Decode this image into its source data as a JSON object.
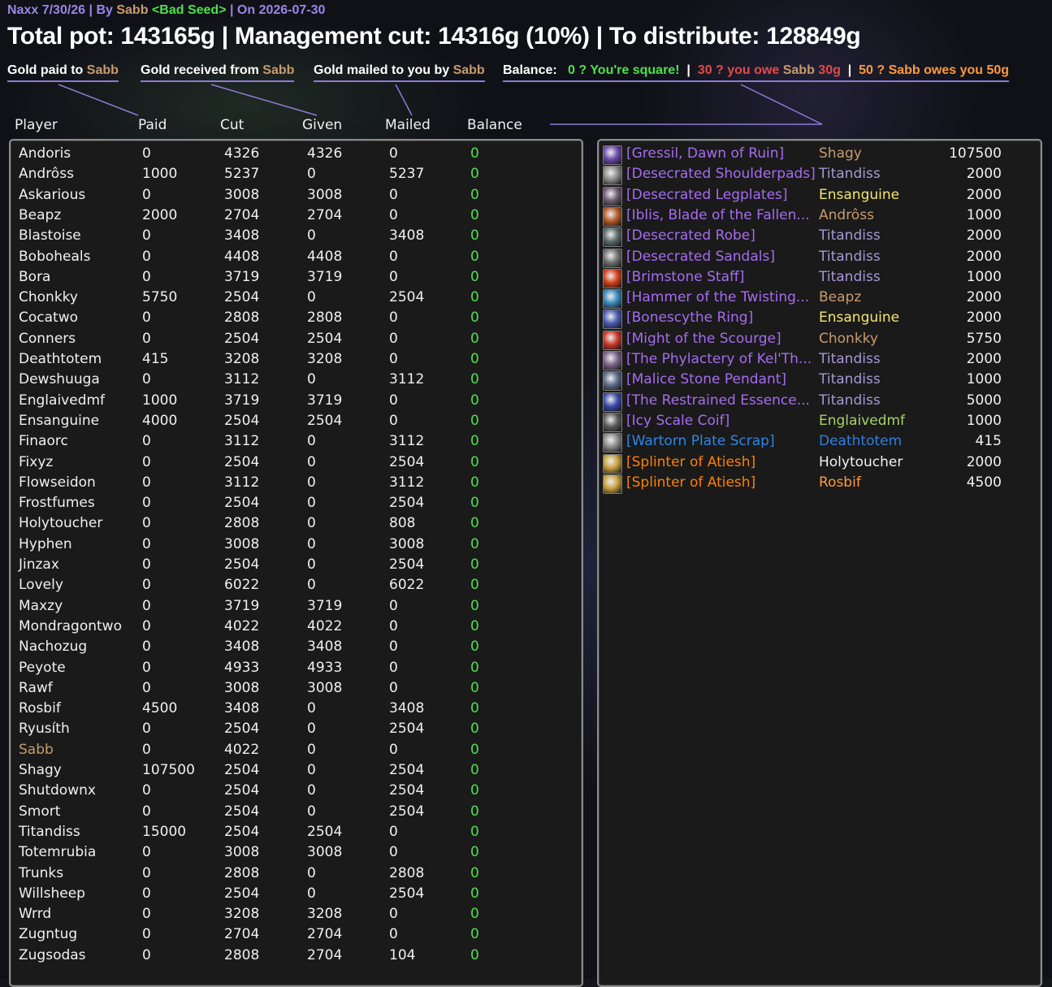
{
  "header": {
    "raid": "Naxx 7/30/26",
    "by_label": "By",
    "author": "Sabb",
    "guild": "<Bad Seed>",
    "on_label": "On 2026-07-30",
    "title": "Total pot: 143165g | Management cut: 14316g (10%) | To distribute: 128849g"
  },
  "legend": {
    "paid_prefix": "Gold paid to ",
    "paid_name": "Sabb",
    "received_prefix": "Gold received from ",
    "received_name": "Sabb",
    "mailed_prefix": "Gold mailed to you by ",
    "mailed_name": "Sabb",
    "balance_label": "Balance:",
    "balance_zero": "0 ? You're square!",
    "sep": "|",
    "balance_owe_a": "30 ? you owe ",
    "balance_owe_name": "Sabb",
    "balance_owe_b": " 30g",
    "balance_owed": "50 ? Sabb owes you 50g"
  },
  "columns": [
    "Player",
    "Paid",
    "Cut",
    "Given",
    "Mailed",
    "Balance"
  ],
  "players": [
    {
      "name": "Andoris",
      "paid": "0",
      "cut": "4326",
      "given": "4326",
      "mailed": "0",
      "balance": "0"
    },
    {
      "name": "Andrôss",
      "paid": "1000",
      "cut": "5237",
      "given": "0",
      "mailed": "5237",
      "balance": "0"
    },
    {
      "name": "Askarious",
      "paid": "0",
      "cut": "3008",
      "given": "3008",
      "mailed": "0",
      "balance": "0"
    },
    {
      "name": "Beapz",
      "paid": "2000",
      "cut": "2704",
      "given": "2704",
      "mailed": "0",
      "balance": "0"
    },
    {
      "name": "Blastoise",
      "paid": "0",
      "cut": "3408",
      "given": "0",
      "mailed": "3408",
      "balance": "0"
    },
    {
      "name": "Boboheals",
      "paid": "0",
      "cut": "4408",
      "given": "4408",
      "mailed": "0",
      "balance": "0"
    },
    {
      "name": "Bora",
      "paid": "0",
      "cut": "3719",
      "given": "3719",
      "mailed": "0",
      "balance": "0"
    },
    {
      "name": "Chonkky",
      "paid": "5750",
      "cut": "2504",
      "given": "0",
      "mailed": "2504",
      "balance": "0"
    },
    {
      "name": "Cocatwo",
      "paid": "0",
      "cut": "2808",
      "given": "2808",
      "mailed": "0",
      "balance": "0"
    },
    {
      "name": "Conners",
      "paid": "0",
      "cut": "2504",
      "given": "2504",
      "mailed": "0",
      "balance": "0"
    },
    {
      "name": "Deathtotem",
      "paid": "415",
      "cut": "3208",
      "given": "3208",
      "mailed": "0",
      "balance": "0"
    },
    {
      "name": "Dewshuuga",
      "paid": "0",
      "cut": "3112",
      "given": "0",
      "mailed": "3112",
      "balance": "0"
    },
    {
      "name": "Englaivedmf",
      "paid": "1000",
      "cut": "3719",
      "given": "3719",
      "mailed": "0",
      "balance": "0"
    },
    {
      "name": "Ensanguine",
      "paid": "4000",
      "cut": "2504",
      "given": "2504",
      "mailed": "0",
      "balance": "0"
    },
    {
      "name": "Finaorc",
      "paid": "0",
      "cut": "3112",
      "given": "0",
      "mailed": "3112",
      "balance": "0"
    },
    {
      "name": "Fixyz",
      "paid": "0",
      "cut": "2504",
      "given": "0",
      "mailed": "2504",
      "balance": "0"
    },
    {
      "name": "Flowseidon",
      "paid": "0",
      "cut": "3112",
      "given": "0",
      "mailed": "3112",
      "balance": "0"
    },
    {
      "name": "Frostfumes",
      "paid": "0",
      "cut": "2504",
      "given": "0",
      "mailed": "2504",
      "balance": "0"
    },
    {
      "name": "Holytoucher",
      "paid": "0",
      "cut": "2808",
      "given": "0",
      "mailed": "808",
      "balance": "0"
    },
    {
      "name": "Hyphen",
      "paid": "0",
      "cut": "3008",
      "given": "0",
      "mailed": "3008",
      "balance": "0"
    },
    {
      "name": "Jinzax",
      "paid": "0",
      "cut": "2504",
      "given": "0",
      "mailed": "2504",
      "balance": "0"
    },
    {
      "name": "Lovely",
      "paid": "0",
      "cut": "6022",
      "given": "0",
      "mailed": "6022",
      "balance": "0"
    },
    {
      "name": "Maxzy",
      "paid": "0",
      "cut": "3719",
      "given": "3719",
      "mailed": "0",
      "balance": "0"
    },
    {
      "name": "Mondragontwo",
      "paid": "0",
      "cut": "4022",
      "given": "4022",
      "mailed": "0",
      "balance": "0"
    },
    {
      "name": "Nachozug",
      "paid": "0",
      "cut": "3408",
      "given": "3408",
      "mailed": "0",
      "balance": "0"
    },
    {
      "name": "Peyote",
      "paid": "0",
      "cut": "4933",
      "given": "4933",
      "mailed": "0",
      "balance": "0"
    },
    {
      "name": "Rawf",
      "paid": "0",
      "cut": "3008",
      "given": "3008",
      "mailed": "0",
      "balance": "0"
    },
    {
      "name": "Rosbif",
      "paid": "4500",
      "cut": "3408",
      "given": "0",
      "mailed": "3408",
      "balance": "0"
    },
    {
      "name": "Ryusíth",
      "paid": "0",
      "cut": "2504",
      "given": "0",
      "mailed": "2504",
      "balance": "0"
    },
    {
      "name": "Sabb",
      "paid": "0",
      "cut": "4022",
      "given": "0",
      "mailed": "0",
      "balance": "0",
      "color": "#c89b6e"
    },
    {
      "name": "Shagy",
      "paid": "107500",
      "cut": "2504",
      "given": "0",
      "mailed": "2504",
      "balance": "0"
    },
    {
      "name": "Shutdownx",
      "paid": "0",
      "cut": "2504",
      "given": "0",
      "mailed": "2504",
      "balance": "0"
    },
    {
      "name": "Smort",
      "paid": "0",
      "cut": "2504",
      "given": "0",
      "mailed": "2504",
      "balance": "0"
    },
    {
      "name": "Titandiss",
      "paid": "15000",
      "cut": "2504",
      "given": "2504",
      "mailed": "0",
      "balance": "0"
    },
    {
      "name": "Totemrubia",
      "paid": "0",
      "cut": "3008",
      "given": "3008",
      "mailed": "0",
      "balance": "0"
    },
    {
      "name": "Trunks",
      "paid": "0",
      "cut": "2808",
      "given": "0",
      "mailed": "2808",
      "balance": "0"
    },
    {
      "name": "Willsheep",
      "paid": "0",
      "cut": "2504",
      "given": "0",
      "mailed": "2504",
      "balance": "0"
    },
    {
      "name": "Wrrd",
      "paid": "0",
      "cut": "3208",
      "given": "3208",
      "mailed": "0",
      "balance": "0"
    },
    {
      "name": "Zugntug",
      "paid": "0",
      "cut": "2704",
      "given": "2704",
      "mailed": "0",
      "balance": "0"
    },
    {
      "name": "Zugsodas",
      "paid": "0",
      "cut": "2808",
      "given": "2704",
      "mailed": "104",
      "balance": "0"
    }
  ],
  "items": [
    {
      "item": "[Gressil, Dawn of Ruin]",
      "winner": "Shagy",
      "amount": "107500",
      "item_color": "#a66cf0",
      "winner_color": "#c89b6e",
      "icon": "sword-icon",
      "icon_color": "#6a4aa8"
    },
    {
      "item": "[Desecrated Shoulderpads]",
      "winner": "Titandiss",
      "amount": "2000",
      "item_color": "#a66cf0",
      "winner_color": "#a599d6",
      "icon": "shoulder-icon",
      "icon_color": "#8a8a8a"
    },
    {
      "item": "[Desecrated Legplates]",
      "winner": "Ensanguine",
      "amount": "2000",
      "item_color": "#a66cf0",
      "winner_color": "#f5e66e",
      "icon": "legs-icon",
      "icon_color": "#6c5a70"
    },
    {
      "item": "[Iblis, Blade of the Fallen...",
      "winner": "Andrôss",
      "amount": "1000",
      "item_color": "#a66cf0",
      "winner_color": "#c89b6e",
      "icon": "blade-icon",
      "icon_color": "#b45a2a"
    },
    {
      "item": "[Desecrated Robe]",
      "winner": "Titandiss",
      "amount": "2000",
      "item_color": "#a66cf0",
      "winner_color": "#a599d6",
      "icon": "robe-icon",
      "icon_color": "#5c6a6a"
    },
    {
      "item": "[Desecrated Sandals]",
      "winner": "Titandiss",
      "amount": "2000",
      "item_color": "#a66cf0",
      "winner_color": "#a599d6",
      "icon": "boots-icon",
      "icon_color": "#707070"
    },
    {
      "item": "[Brimstone Staff]",
      "winner": "Titandiss",
      "amount": "1000",
      "item_color": "#a66cf0",
      "winner_color": "#a599d6",
      "icon": "staff-icon",
      "icon_color": "#d2401c"
    },
    {
      "item": "[Hammer of the Twisting...",
      "winner": "Beapz",
      "amount": "2000",
      "item_color": "#a66cf0",
      "winner_color": "#c89b6e",
      "icon": "hammer-icon",
      "icon_color": "#3a88b8"
    },
    {
      "item": "[Bonescythe Ring]",
      "winner": "Ensanguine",
      "amount": "2000",
      "item_color": "#a66cf0",
      "winner_color": "#f5e66e",
      "icon": "ring-icon",
      "icon_color": "#4a5ab0"
    },
    {
      "item": "[Might of the Scourge]",
      "winner": "Chonkky",
      "amount": "5750",
      "item_color": "#a66cf0",
      "winner_color": "#c89b6e",
      "icon": "enchant-icon",
      "icon_color": "#c8382a"
    },
    {
      "item": "[The Phylactery of Kel'Th...",
      "winner": "Titandiss",
      "amount": "2000",
      "item_color": "#a66cf0",
      "winner_color": "#a599d6",
      "icon": "phylactery-icon",
      "icon_color": "#7a6488"
    },
    {
      "item": "[Malice Stone Pendant]",
      "winner": "Titandiss",
      "amount": "1000",
      "item_color": "#a66cf0",
      "winner_color": "#a599d6",
      "icon": "necklace-icon",
      "icon_color": "#5a6a88"
    },
    {
      "item": "[The Restrained Essence...",
      "winner": "Titandiss",
      "amount": "5000",
      "item_color": "#a66cf0",
      "winner_color": "#a599d6",
      "icon": "orb-icon",
      "icon_color": "#3a4aa8"
    },
    {
      "item": "[Icy Scale Coif]",
      "winner": "Englaivedmf",
      "amount": "1000",
      "item_color": "#a66cf0",
      "winner_color": "#a6d36a",
      "icon": "helm-icon",
      "icon_color": "#5a5a5a"
    },
    {
      "item": "[Wartorn Plate Scrap]",
      "winner": "Deathtotem",
      "amount": "415",
      "item_color": "#2f86e6",
      "winner_color": "#2f7fe0",
      "icon": "scrap-icon",
      "icon_color": "#8a8a8a"
    },
    {
      "item": "[Splinter of Atiesh]",
      "winner": "Holytoucher",
      "amount": "2000",
      "item_color": "#ff8000",
      "winner_color": "#f0f0f0",
      "icon": "splinter-icon",
      "icon_color": "#c8a040"
    },
    {
      "item": "[Splinter of Atiesh]",
      "winner": "Rosbif",
      "amount": "4500",
      "item_color": "#ff8000",
      "winner_color": "#ff9a3c",
      "icon": "splinter-icon",
      "icon_color": "#c8a040"
    }
  ]
}
